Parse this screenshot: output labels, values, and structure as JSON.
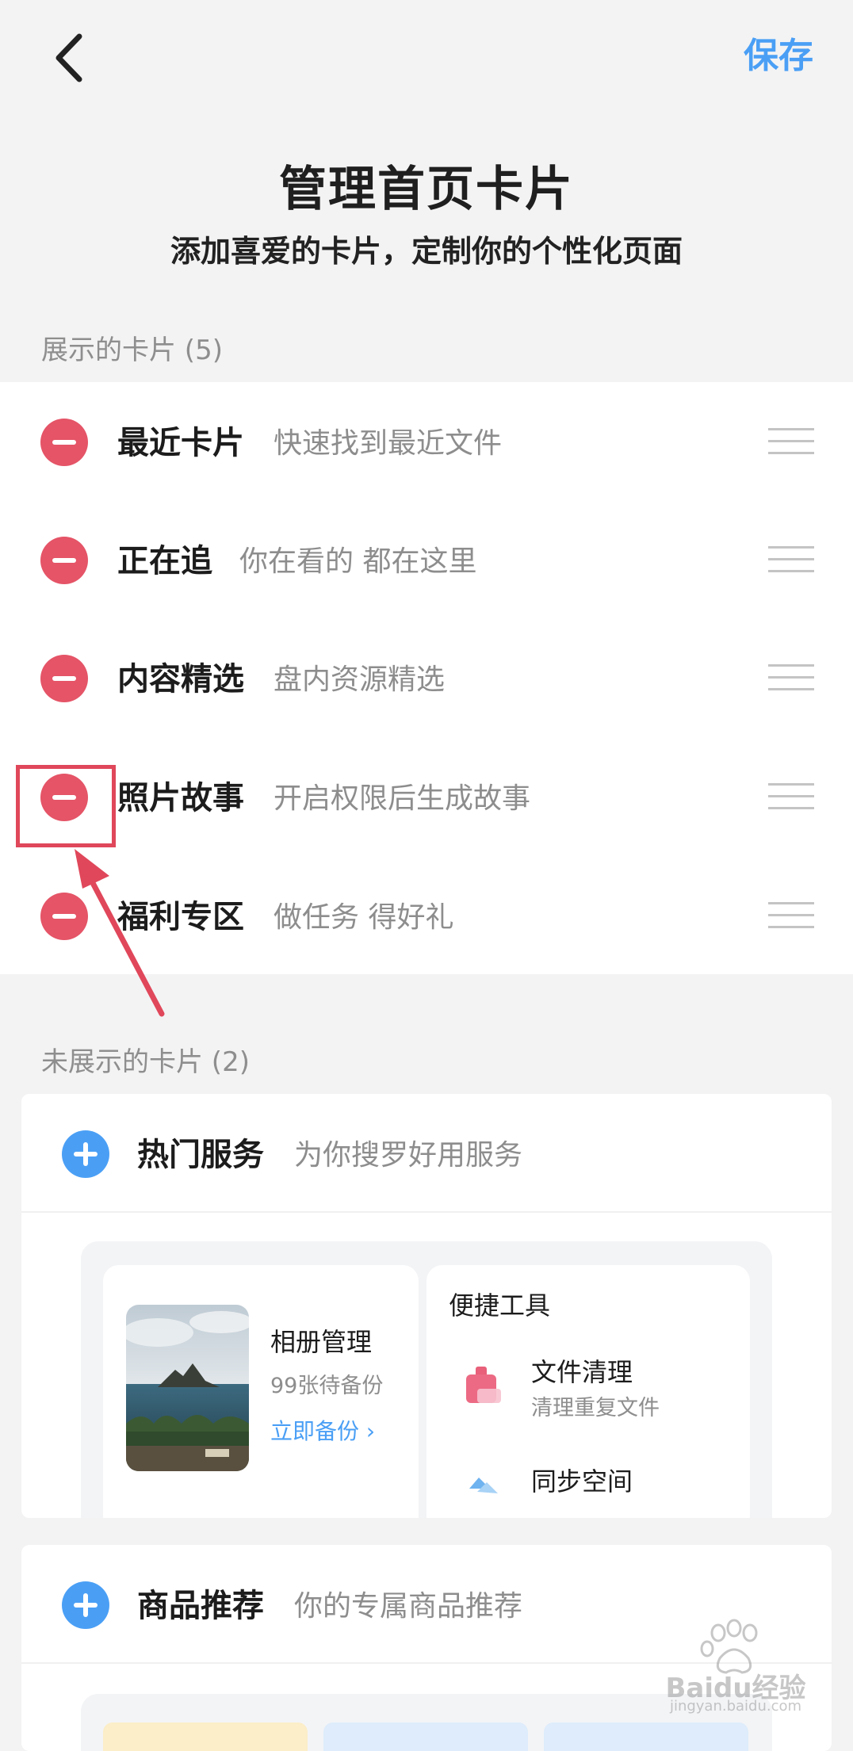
{
  "header": {
    "back_icon": "chevron-left-icon",
    "save_label": "保存",
    "title": "管理首页卡片",
    "subtitle": "添加喜爱的卡片，定制你的个性化页面"
  },
  "shown_section": {
    "label": "展示的卡片 (5)",
    "items": [
      {
        "title": "最近卡片",
        "desc": "快速找到最近文件"
      },
      {
        "title": "正在追",
        "desc": "你在看的 都在这里"
      },
      {
        "title": "内容精选",
        "desc": "盘内资源精选"
      },
      {
        "title": "照片故事",
        "desc": "开启权限后生成故事"
      },
      {
        "title": "福利专区",
        "desc": "做任务 得好礼"
      }
    ]
  },
  "hidden_section": {
    "label": "未展示的卡片 (2)",
    "cards": [
      {
        "title": "热门服务",
        "desc": "为你搜罗好用服务",
        "preview": {
          "album": {
            "title": "相册管理",
            "sub": "99张待备份",
            "link": "立即备份"
          },
          "tools": {
            "heading": "便捷工具",
            "item1_title": "文件清理",
            "item1_sub": "清理重复文件",
            "item2_title": "同步空间"
          }
        }
      },
      {
        "title": "商品推荐",
        "desc": "你的专属商品推荐"
      }
    ]
  },
  "watermark": {
    "text": "Baidu经验",
    "sub": "jingyan.baidu.com"
  },
  "colors": {
    "accent": "#4a9ff5",
    "remove": "#e55467",
    "annotation": "#e0475a"
  }
}
